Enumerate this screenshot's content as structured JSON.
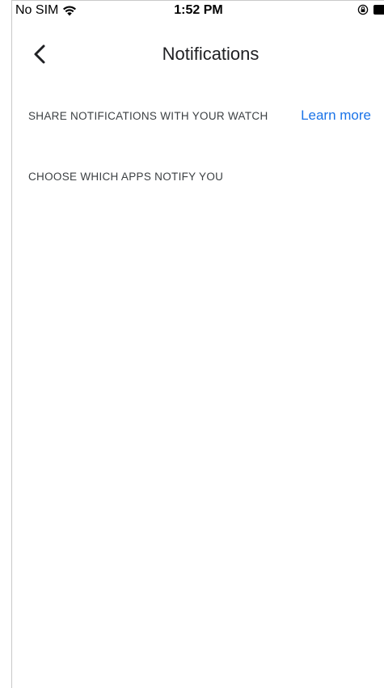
{
  "status_bar": {
    "carrier": "No SIM",
    "time": "1:52 PM"
  },
  "nav": {
    "title": "Notifications"
  },
  "sections": {
    "share_label": "SHARE NOTIFICATIONS WITH YOUR WATCH",
    "learn_more_label": "Learn more",
    "choose_label": "CHOOSE WHICH APPS NOTIFY YOU"
  },
  "colors": {
    "link": "#1a73e8",
    "section_text": "#3c4043",
    "title_text": "#202124"
  },
  "icons": {
    "wifi": "wifi-icon",
    "rotation_lock": "rotation-lock-icon",
    "battery": "battery-icon",
    "back": "chevron-left-icon"
  }
}
